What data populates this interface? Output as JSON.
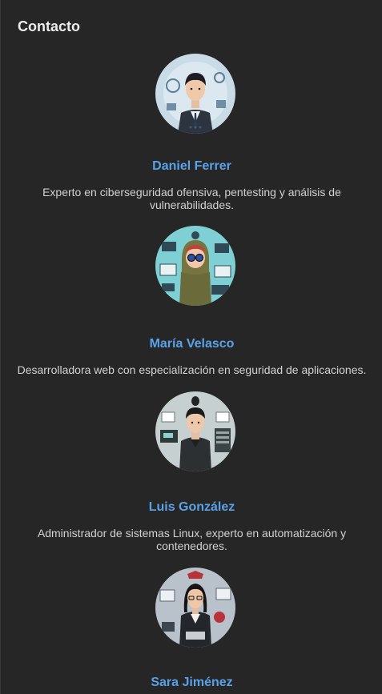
{
  "section": {
    "title": "Contacto"
  },
  "contacts": [
    {
      "name": "Daniel Ferrer",
      "description": "Experto en ciberseguridad ofensiva, pentesting y análisis de vulnerabilidades."
    },
    {
      "name": "María Velasco",
      "description": "Desarrolladora web con especialización en seguridad de aplicaciones."
    },
    {
      "name": "Luis González",
      "description": "Administrador de sistemas Linux, experto en automatización y contenedores."
    },
    {
      "name": "Sara Jiménez",
      "description": ""
    }
  ]
}
